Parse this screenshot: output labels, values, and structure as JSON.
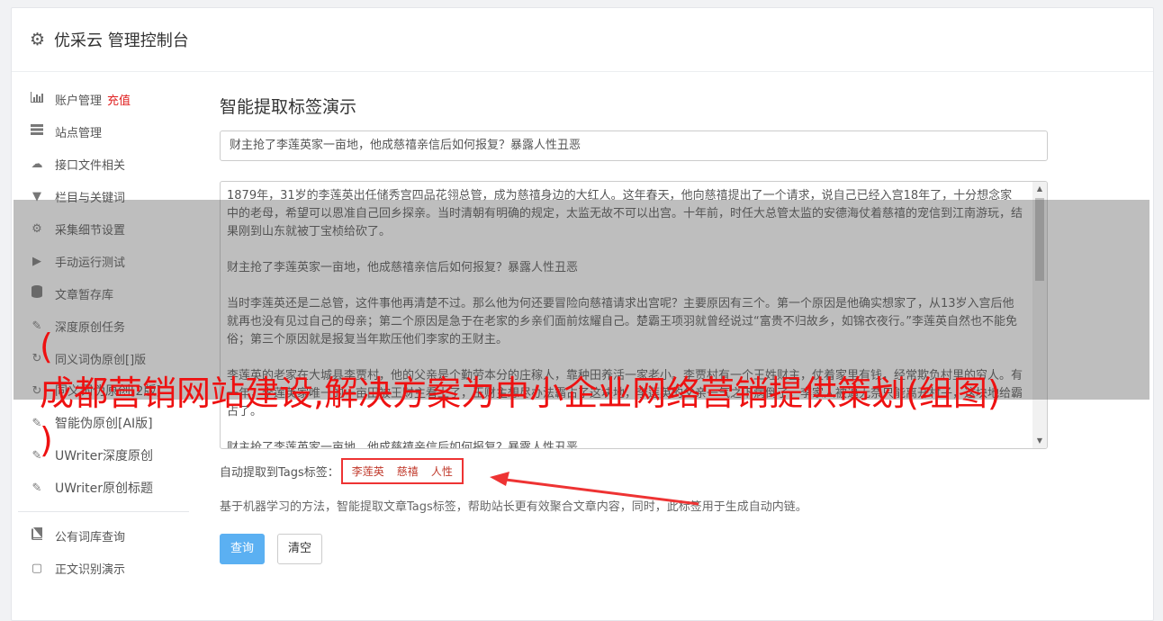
{
  "header": {
    "title": "优采云 管理控制台",
    "icon": "gear-icon"
  },
  "sidebar": {
    "items": [
      {
        "label": "账户管理",
        "badge": "充值",
        "icon": "bar-chart-icon"
      },
      {
        "label": "站点管理",
        "icon": "server-icon"
      },
      {
        "label": "接口文件相关",
        "icon": "cloud-upload-icon"
      },
      {
        "label": "栏目与关键词",
        "icon": "filter-icon"
      },
      {
        "label": "采集细节设置",
        "icon": "gears-icon"
      },
      {
        "label": "手动运行测试",
        "icon": "play-icon"
      },
      {
        "label": "文章暂存库",
        "icon": "database-icon"
      },
      {
        "label": "深度原创任务",
        "icon": "edit-icon"
      },
      {
        "label": "同义词伪原创[]版",
        "icon": "refresh-icon"
      },
      {
        "label": "同义词伪原创[2版]",
        "icon": "refresh-icon"
      },
      {
        "label": "智能伪原创[AI版]",
        "icon": "edit-icon"
      },
      {
        "label": "UWriter深度原创",
        "icon": "edit-icon"
      },
      {
        "label": "UWriter原创标题",
        "icon": "edit-icon"
      }
    ],
    "items2": [
      {
        "label": "公有词库查询",
        "icon": "book-icon"
      },
      {
        "label": "正文识别演示",
        "icon": "square-icon"
      }
    ]
  },
  "main": {
    "section_title": "智能提取标签演示",
    "title_value": "财主抢了李莲英家一亩地，他成慈禧亲信后如何报复？暴露人性丑恶",
    "content_paragraphs": [
      "1879年，31岁的李莲英出任储秀宫四品花翎总管，成为慈禧身边的大红人。这年春天，他向慈禧提出了一个请求，说自己已经入宫18年了，十分想念家中的老母，希望可以恩准自己回乡探亲。当时清朝有明确的规定，太监无故不可以出宫。十年前，时任大总管太监的安德海仗着慈禧的宠信到江南游玩，结果刚到山东就被丁宝桢给砍了。",
      "财主抢了李莲英家一亩地，他成慈禧亲信后如何报复？暴露人性丑恶",
      "当时李莲英还是二总管，这件事他再清楚不过。那么他为何还要冒险向慈禧请求出宫呢？主要原因有三个。第一个原因是他确实想家了，从13岁入宫后他就再也没有见过自己的母亲；第二个原因是急于在老家的乡亲们面前炫耀自己。楚霸王项羽就曾经说过“富贵不归故乡，如锦衣夜行。”李莲英自然也不能免俗；第三个原因就是报复当年欺压他们李家的王财主。",
      "李莲英的老家在大城县李贾村，他的父亲是个勤劳本分的庄稼人，靠种田养活一家老小。李贾村有一个王姓财主，仗着家里有钱，经常欺负村里的穷人。有一年，李莲英家唯一的一亩田被王财主看上了，王财主想尽办法霸占了这块地，李莲英的父亲一气之下病倒了，李家人被逼无奈只能离开村子，这块地给霸占了。",
      "财主抢了李莲英家一亩地，他成慈禧亲信后如何报复？暴露人性丑恶"
    ],
    "tags_label": "自动提取到Tags标签：",
    "tags": [
      "李莲英",
      "慈禧",
      "人性"
    ],
    "description": "基于机器学习的方法，智能提取文章Tags标签，帮助站长更有效聚合文章内容，同时，此标签用于生成自动内链。",
    "query_button": "查询",
    "clear_button": "清空"
  },
  "watermark": {
    "text": "(\n成都营销网站建设,解决方案为中小企业网络营销提供策划(组图)\n)",
    "color": "#ee1111"
  },
  "colors": {
    "accent": "#5bb0f2",
    "highlight": "#e33333",
    "recharge": "#e02020"
  }
}
